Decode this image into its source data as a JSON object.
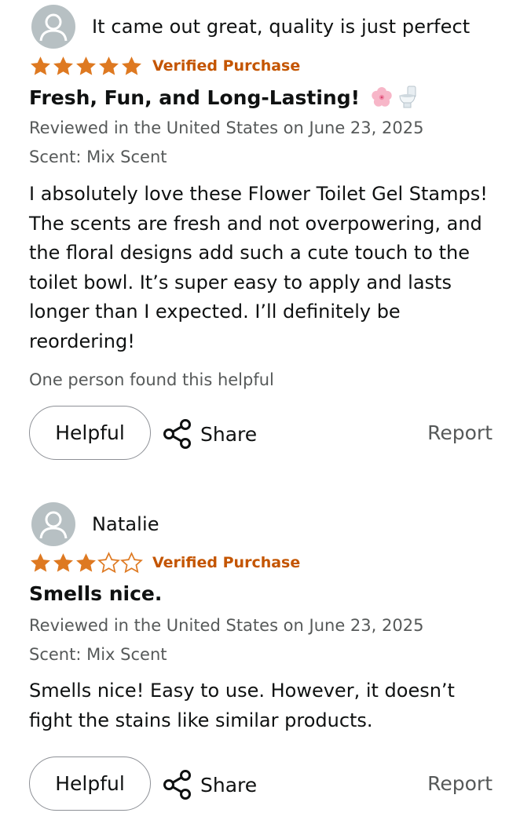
{
  "reviews": [
    {
      "reviewer": "It came out great, quality is just perfect",
      "rating": 5,
      "rating_max": 5,
      "verified": "Verified Purchase",
      "title": "Fresh, Fun, and Long-Lasting!",
      "title_icons": [
        "cherry-blossom-icon",
        "toilet-icon"
      ],
      "date": "Reviewed in the United States on June 23, 2025",
      "scent": "Scent: Mix Scent",
      "body": "I absolutely love these Flower Toilet Gel Stamps! The scents are fresh and not overpowering, and the floral designs add such a cute touch to the toilet bowl. It’s super easy to apply and lasts longer than I expected. I’ll definitely be reordering!",
      "helpful_count": "One person found this helpful",
      "helpful_label": "Helpful",
      "share_label": "Share",
      "report_label": "Report"
    },
    {
      "reviewer": "Natalie",
      "rating": 3,
      "rating_max": 5,
      "verified": "Verified Purchase",
      "title": "Smells nice.",
      "date": "Reviewed in the United States on June 23, 2025",
      "scent": "Scent: Mix Scent",
      "body": "Smells nice! Easy to use. However, it doesn’t fight the stains like similar products.",
      "helpful_label": "Helpful",
      "share_label": "Share",
      "report_label": "Report"
    }
  ],
  "colors": {
    "star": "#de7921",
    "verified": "#c45500",
    "secondary_text": "#565959",
    "avatar_bg": "#b7c0c3"
  }
}
